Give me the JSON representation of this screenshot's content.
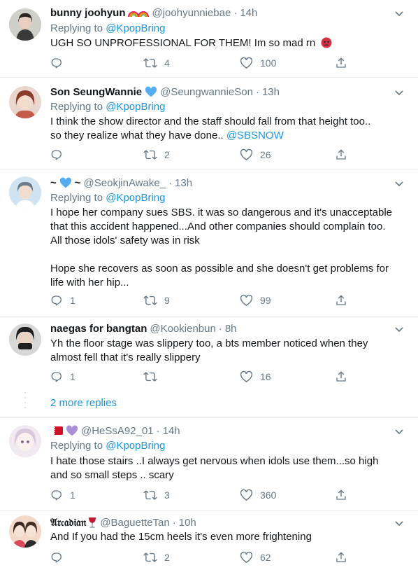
{
  "tweets": [
    {
      "name": "bunny joohyun",
      "handle": "@joohyunniebae",
      "time": "14h",
      "replying_prefix": "Replying to",
      "replying_to": "@KpopBring",
      "lines": [
        "UGH SO UNPROFESSIONAL FOR THEM! Im so mad rn"
      ],
      "reply_count": "",
      "retweet_count": "4",
      "like_count": "100"
    },
    {
      "name": "Son SeungWannie",
      "handle": "@SeungwannieSon",
      "time": "13h",
      "replying_prefix": "Replying to",
      "replying_to": "@KpopBring",
      "lines": [
        "I think the show director and the staff should fall from that height too..",
        "so they realize what they have done.."
      ],
      "mention": "@SBSNOW",
      "reply_count": "",
      "retweet_count": "2",
      "like_count": "26"
    },
    {
      "name": "~",
      "name_suffix": "~",
      "handle": "@SeokjinAwake_",
      "time": "13h",
      "replying_prefix": "Replying to",
      "replying_to": "@KpopBring",
      "lines": [
        "I hope her company sues SBS. it was so dangerous and it's unacceptable",
        "that this accident happened...And other companies should complain too.",
        "All those idols' safety was in risk",
        "",
        "Hope she recovers as soon as possible and she doesn't get problems for",
        "life with her hip..."
      ],
      "reply_count": "1",
      "retweet_count": "9",
      "like_count": "99"
    },
    {
      "name": "naegas for bangtan",
      "handle": "@Kookienbun",
      "time": "8h",
      "lines": [
        "Yh the floor stage was slippery too, a bts member noticed when they",
        "almost fell that it's really slippery"
      ],
      "reply_count": "1",
      "retweet_count": "",
      "like_count": "16"
    },
    {
      "name": "",
      "handle": "@HeSsA92_01",
      "time": "14h",
      "replying_prefix": "Replying to",
      "replying_to": "@KpopBring",
      "lines": [
        "I hate those  stairs ..I always get nervous when idols use them...so high",
        "and so small steps .. scary"
      ],
      "reply_count": "1",
      "retweet_count": "3",
      "like_count": "360"
    },
    {
      "name": "𝔄𝔯𝔠𝔞𝔡𝔦𝔞𝔫",
      "handle": "@BaguetteTan",
      "time": "10h",
      "lines": [
        "And If you had the 15cm heels it's even more frightening"
      ],
      "reply_count": "",
      "retweet_count": "2",
      "like_count": "62"
    }
  ],
  "more_replies": "2 more replies",
  "dot": "·",
  "colors": {
    "text": "#14171a",
    "muted": "#657786",
    "link": "#1b95e0",
    "divider": "#e6ecf0"
  },
  "icons": [
    "reply-icon",
    "retweet-icon",
    "like-icon",
    "share-icon",
    "chevron-down-icon",
    "rainbow-emoji-icon",
    "blue-heart-icon",
    "angry-face-icon",
    "wine-glass-icon",
    "purple-heart-icon",
    "flag-icon"
  ]
}
